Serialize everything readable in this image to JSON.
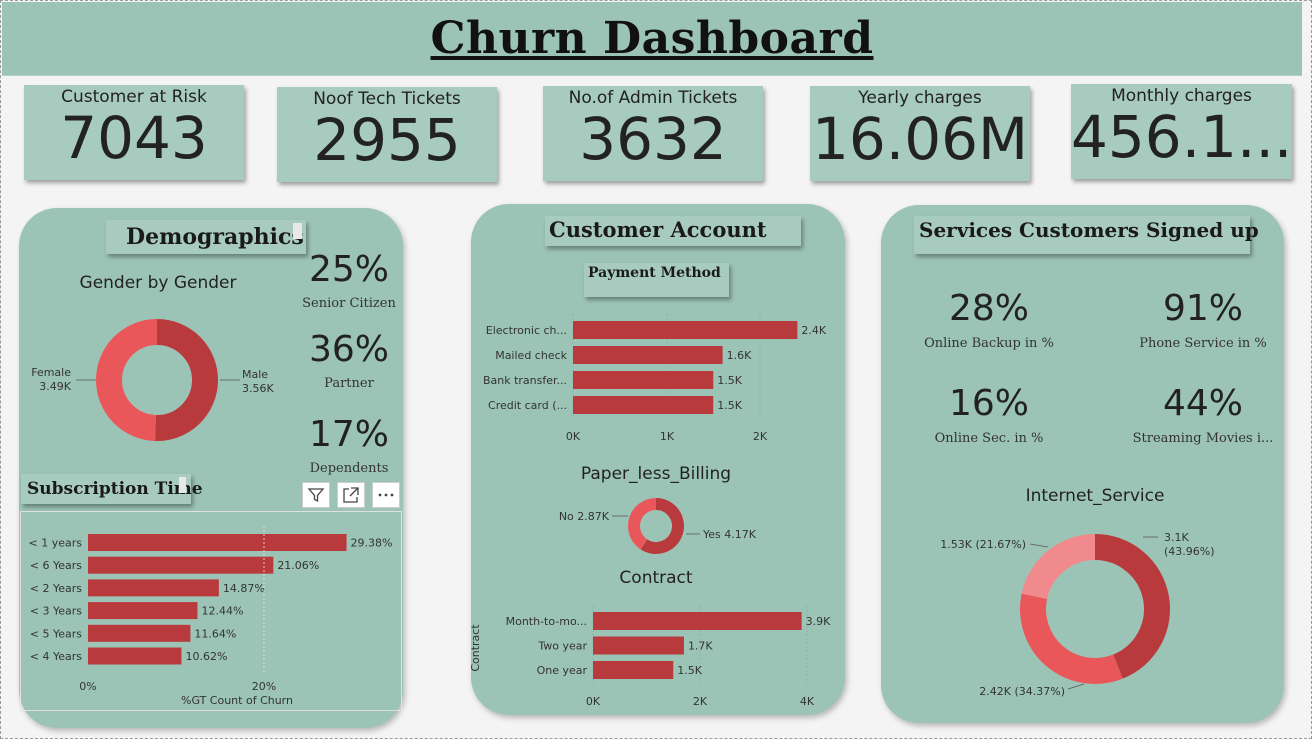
{
  "title": "Churn Dashboard",
  "kpis": [
    {
      "label": "Customer at Risk",
      "value": "7043"
    },
    {
      "label": "Noof Tech Tickets",
      "value": "2955"
    },
    {
      "label": "No.of Admin Tickets",
      "value": "3632"
    },
    {
      "label": "Yearly charges",
      "value": "16.06M"
    },
    {
      "label": "Monthly charges",
      "value": "456.1..."
    }
  ],
  "demographics": {
    "header": "Demographics",
    "gender_title": "Gender by Gender",
    "female_label": "Female",
    "female_value": "3.49K",
    "male_label": "Male",
    "male_value": "3.56K",
    "stats": [
      {
        "value": "25%",
        "label": "Senior Citizen"
      },
      {
        "value": "36%",
        "label": "Partner"
      },
      {
        "value": "17%",
        "label": "Dependents"
      }
    ]
  },
  "subscription": {
    "header": "Subscription Time",
    "xlabel": "%GT Count of Churn",
    "ticks": [
      "0%",
      "20%"
    ]
  },
  "account": {
    "header": "Customer Account",
    "payment_header": "Payment Method",
    "payment_ticks": [
      "0K",
      "1K",
      "2K"
    ],
    "paperless_title": "Paper_less_Billing",
    "paperless_no": "No 2.87K",
    "paperless_yes": "Yes 4.17K",
    "contract_title": "Contract",
    "contract_axis": "Contract",
    "contract_ticks": [
      "0K",
      "2K",
      "4K"
    ]
  },
  "services": {
    "header": "Services Customers Signed up",
    "stats": [
      {
        "value": "28%",
        "label": "Online Backup in %"
      },
      {
        "value": "91%",
        "label": "Phone Service in %"
      },
      {
        "value": "16%",
        "label": "Online Sec. in %"
      },
      {
        "value": "44%",
        "label": "Streaming Movies i..."
      }
    ],
    "internet_title": "Internet_Service",
    "slice_labels": [
      "3.1K",
      "(43.96%)",
      "2.42K (34.37%)",
      "1.53K (21.67%)"
    ]
  },
  "toolbar": {
    "icons": [
      "filter-icon",
      "focus-mode-icon",
      "more-options-icon"
    ]
  },
  "colors": {
    "bar": "#b93a3d",
    "dark_red": "#b93a3d",
    "red": "#e9575b",
    "pink": "#f08a8c",
    "panel": "#9cc4b6"
  },
  "chart_data": [
    {
      "type": "pie",
      "title": "Gender by Gender",
      "categories": [
        "Female",
        "Male"
      ],
      "values": [
        3.49,
        3.56
      ],
      "unit": "K"
    },
    {
      "type": "bar",
      "orientation": "horizontal",
      "title": "Subscription Time",
      "xlabel": "%GT Count of Churn",
      "categories": [
        "< 1 years",
        "< 6 Years",
        "< 2 Years",
        "< 3 Years",
        "< 5 Years",
        "< 4 Years"
      ],
      "values": [
        29.38,
        21.06,
        14.87,
        12.44,
        11.64,
        10.62
      ],
      "labels": [
        "29.38%",
        "21.06%",
        "14.87%",
        "12.44%",
        "11.64%",
        "10.62%"
      ],
      "xlim": [
        0,
        30
      ]
    },
    {
      "type": "bar",
      "orientation": "horizontal",
      "title": "Payment Method",
      "categories": [
        "Electronic ch...",
        "Mailed check",
        "Bank transfer...",
        "Credit card (..."
      ],
      "values": [
        2.4,
        1.6,
        1.5,
        1.5
      ],
      "labels": [
        "2.4K",
        "1.6K",
        "1.5K",
        "1.5K"
      ],
      "xlim": [
        0,
        2.5
      ]
    },
    {
      "type": "pie",
      "title": "Paper_less_Billing",
      "categories": [
        "No",
        "Yes"
      ],
      "values": [
        2.87,
        4.17
      ],
      "unit": "K"
    },
    {
      "type": "bar",
      "orientation": "horizontal",
      "title": "Contract",
      "ylabel": "Contract",
      "categories": [
        "Month-to-mo...",
        "Two year",
        "One year"
      ],
      "values": [
        3.9,
        1.7,
        1.5
      ],
      "labels": [
        "3.9K",
        "1.7K",
        "1.5K"
      ],
      "xlim": [
        0,
        4
      ]
    },
    {
      "type": "pie",
      "title": "Internet_Service",
      "values": [
        3.1,
        2.42,
        1.53
      ],
      "percentages": [
        43.96,
        34.37,
        21.67
      ],
      "unit": "K"
    }
  ]
}
